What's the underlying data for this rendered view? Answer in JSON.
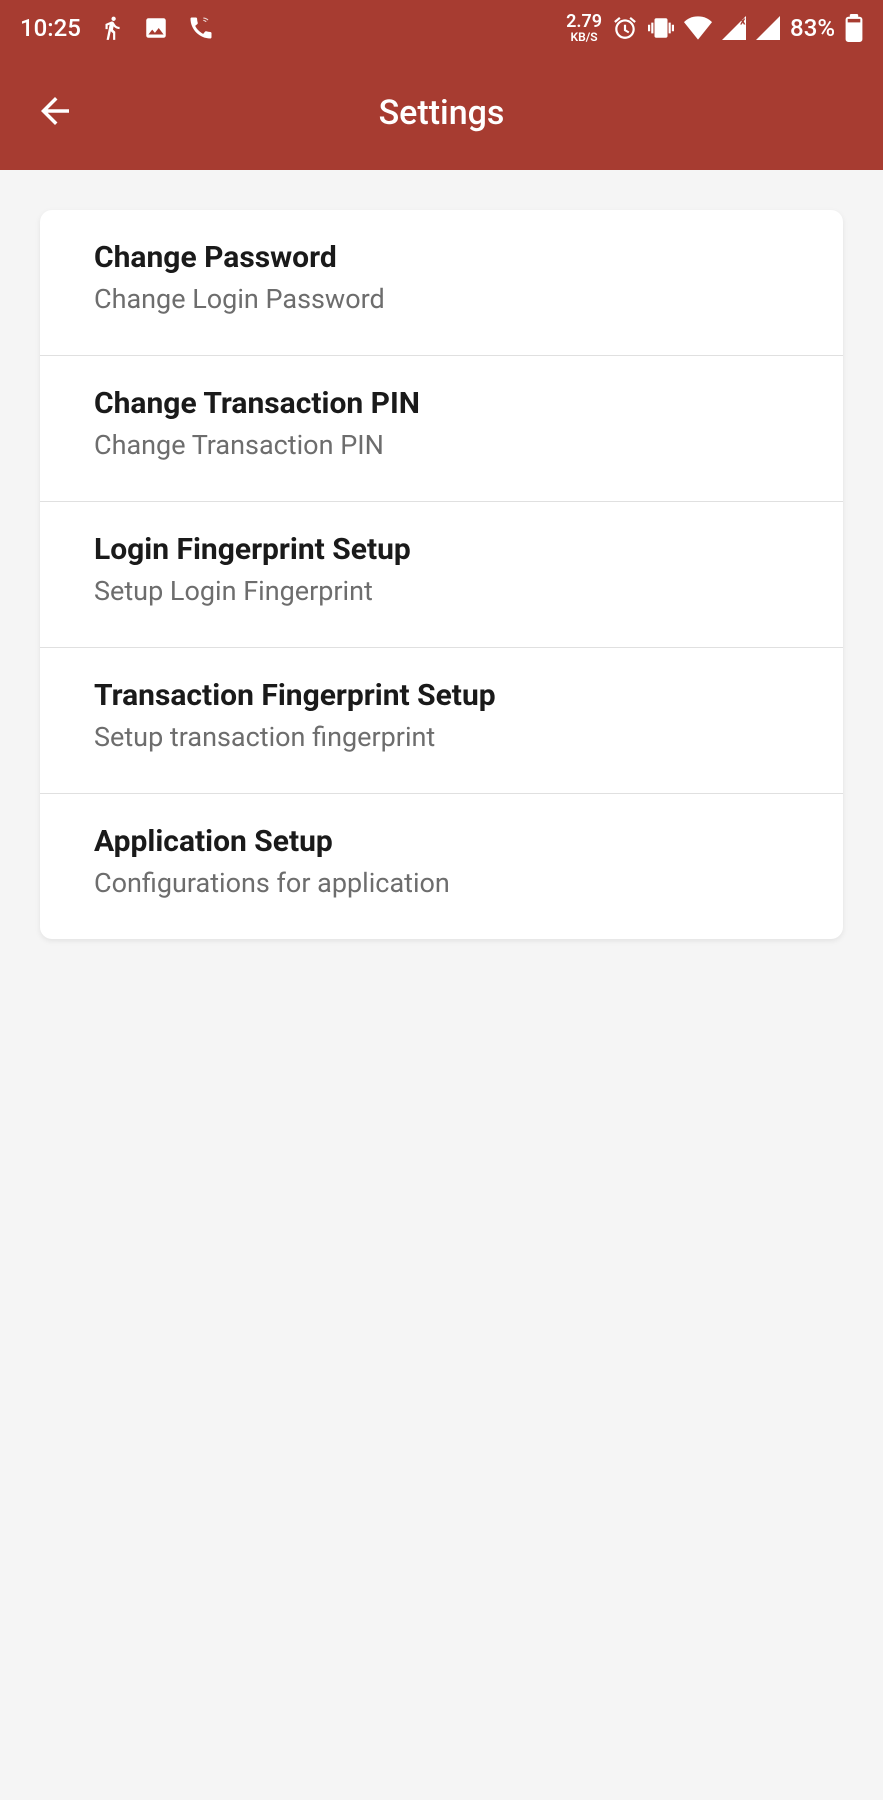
{
  "statusBar": {
    "time": "10:25",
    "networkSpeedValue": "2.79",
    "networkSpeedUnit": "KB/S",
    "batteryPercent": "83%"
  },
  "header": {
    "title": "Settings"
  },
  "settings": {
    "items": [
      {
        "title": "Change Password",
        "subtitle": "Change Login Password"
      },
      {
        "title": "Change Transaction PIN",
        "subtitle": "Change Transaction PIN"
      },
      {
        "title": "Login Fingerprint Setup",
        "subtitle": "Setup Login Fingerprint"
      },
      {
        "title": "Transaction Fingerprint Setup",
        "subtitle": "Setup transaction fingerprint"
      },
      {
        "title": "Application Setup",
        "subtitle": "Configurations for application"
      }
    ]
  }
}
